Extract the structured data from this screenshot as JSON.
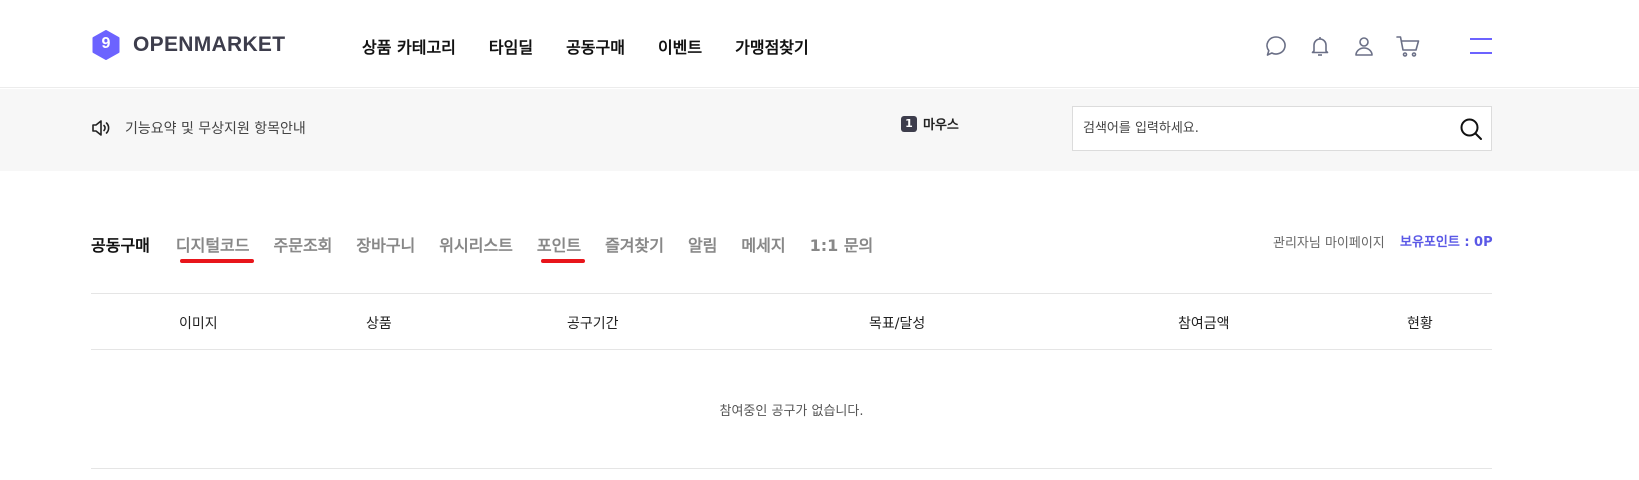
{
  "brand": {
    "name": "OPENMARKET",
    "badge": "9",
    "accent_color": "#6c63ff",
    "text_color": "#3d3d4c"
  },
  "gnb": {
    "items": [
      {
        "label": "상품 카테고리"
      },
      {
        "label": "타임딜"
      },
      {
        "label": "공동구매"
      },
      {
        "label": "이벤트"
      },
      {
        "label": "가맹점찾기"
      }
    ]
  },
  "header_icons": [
    "chat-icon",
    "bell-icon",
    "user-icon",
    "cart-icon",
    "menu-icon"
  ],
  "notice": {
    "icon": "speaker-icon",
    "text": "기능요약 및 무상지원 항목안내"
  },
  "popular": {
    "rank": "1",
    "keyword": "마우스"
  },
  "search": {
    "placeholder": "검색어를 입력하세요.",
    "value": "",
    "icon": "search-icon"
  },
  "mypage": {
    "title": "공동구매",
    "tabs": [
      {
        "label": "디지털코드",
        "marked": true
      },
      {
        "label": "주문조회",
        "marked": false
      },
      {
        "label": "장바구니",
        "marked": false
      },
      {
        "label": "위시리스트",
        "marked": false
      },
      {
        "label": "포인트",
        "marked": true
      },
      {
        "label": "즐겨찾기",
        "marked": false
      },
      {
        "label": "알림",
        "marked": false
      },
      {
        "label": "메세지",
        "marked": false
      },
      {
        "label": "1:1 문의",
        "marked": false
      }
    ],
    "link": "관리자님 마이페이지",
    "points": "보유포인트 : 0P",
    "marker_color": "#e8151b",
    "points_color": "#5a58e6"
  },
  "table": {
    "columns": [
      "이미지",
      "상품",
      "공구기간",
      "목표/달성",
      "참여금액",
      "현황"
    ],
    "empty_message": "참여중인 공구가 없습니다."
  }
}
